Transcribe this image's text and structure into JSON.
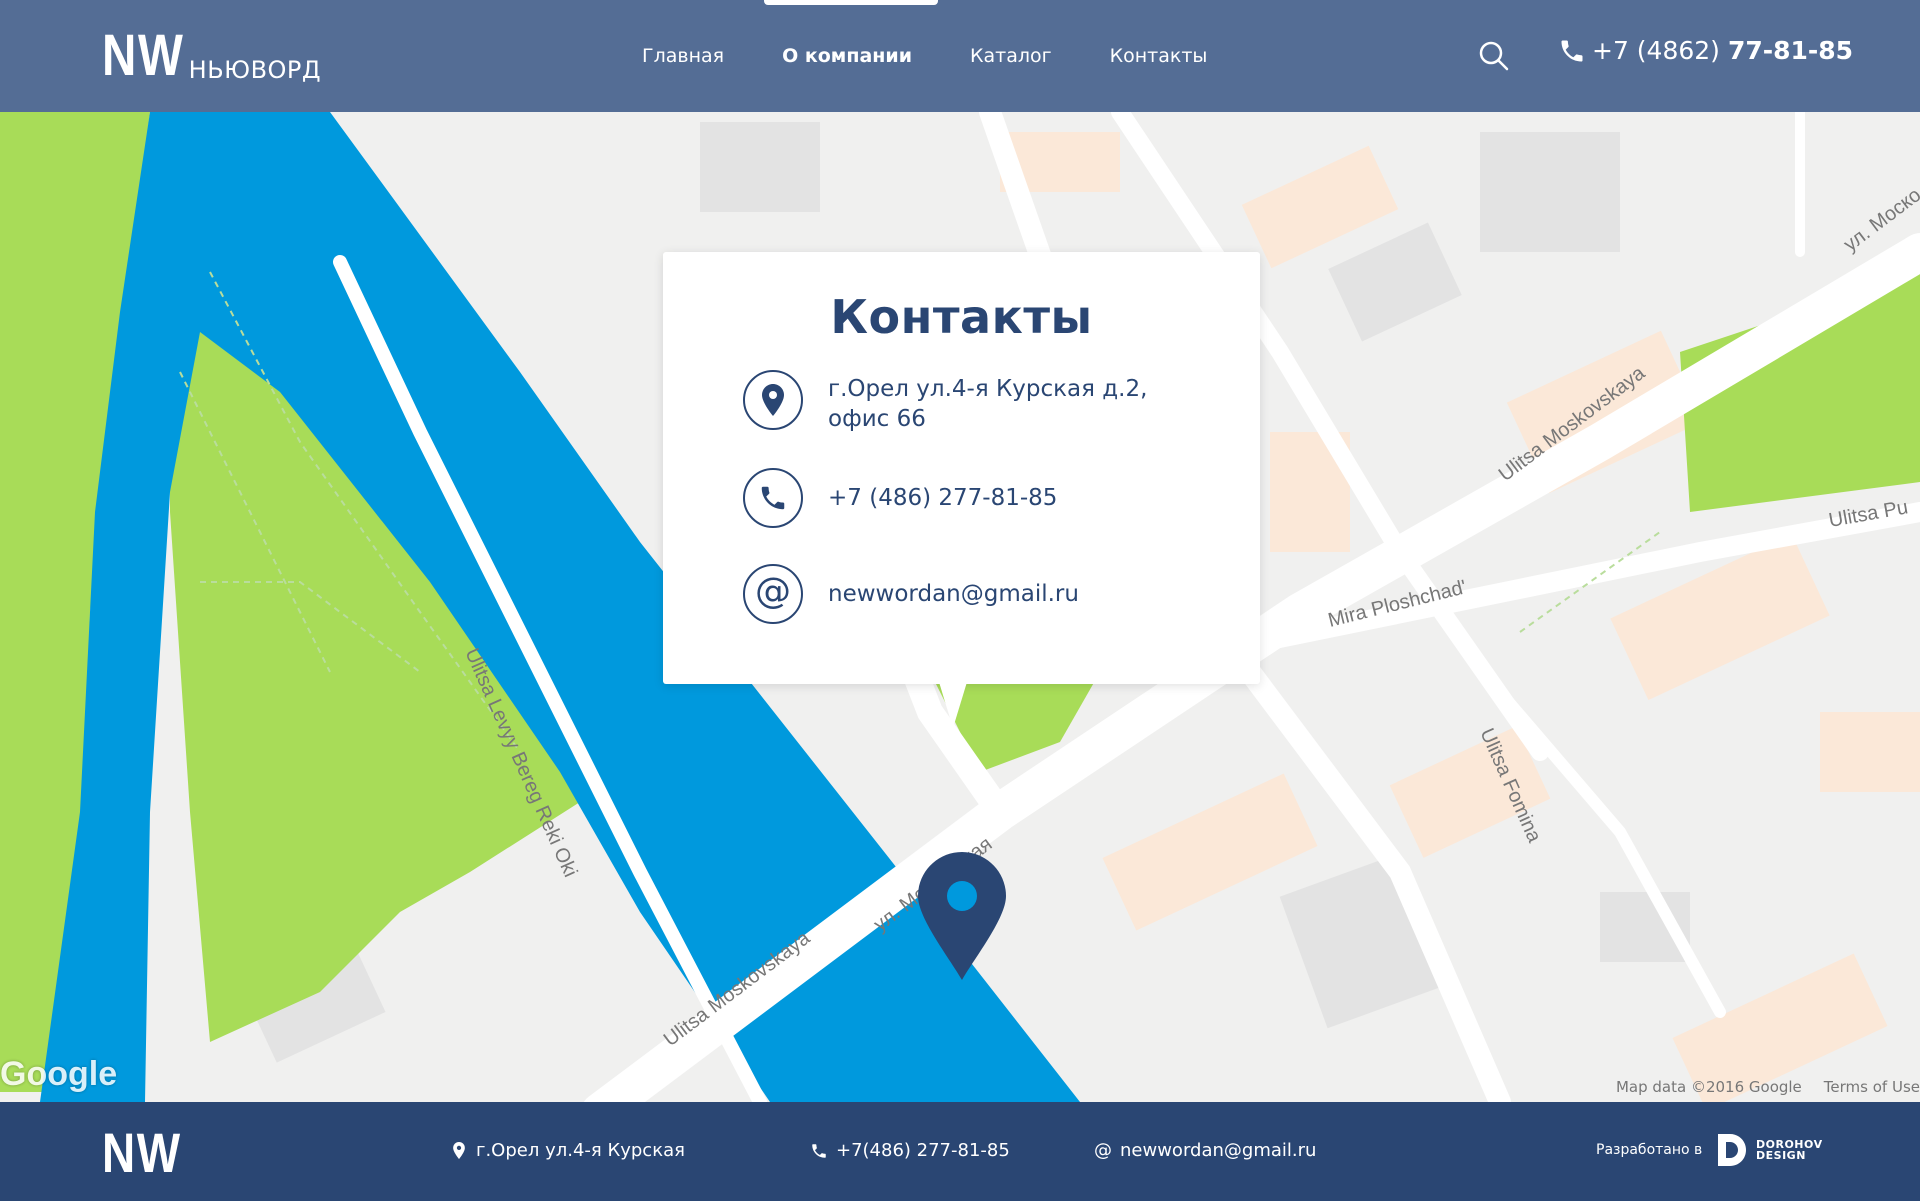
{
  "header": {
    "logo_mark": "NW",
    "logo_text": "НЬЮВОРД",
    "nav": [
      {
        "label": "Главная",
        "active": false
      },
      {
        "label": "О компании",
        "active": true
      },
      {
        "label": "Каталог",
        "active": false
      },
      {
        "label": "Контакты",
        "active": false
      }
    ],
    "phone_prefix": "+7 (4862)",
    "phone_main": "77-81-85",
    "search_icon": "search-icon",
    "phone_icon": "phone-icon"
  },
  "map": {
    "street_labels": [
      "Ulitsa Moskovskaya",
      "ул. Московская",
      "Mira Ploshchad'",
      "Ulitsa Levyy Bereg Reki Oki",
      "Ulitsa Fomina",
      "ул. Моско",
      "Ulitsa Pu"
    ],
    "google_logo": "Google",
    "attribution": "Map data ©2016 Google",
    "terms": "Terms of Use"
  },
  "contacts_card": {
    "title": "Контакты",
    "address_line1": "г.Орел ул.4-я Курская д.2,",
    "address_line2": "офис 66",
    "phone": "+7 (486) 277-81-85",
    "email": "newwordan@gmail.ru",
    "icons": [
      "location-pin-icon",
      "phone-icon",
      "at-icon"
    ]
  },
  "footer": {
    "logo": "NW",
    "address": "г.Орел ул.4-я Курская",
    "phone": "+7(486)  277-81-85",
    "email": "newwordan@gmail.ru",
    "developed_by": "Разработано в",
    "studio_line1": "DOROHOV",
    "studio_line2": "DESIGN"
  },
  "colors": {
    "header_bg": "#546d95",
    "footer_bg": "#2a4673",
    "accent_dark": "#2a4673",
    "water": "#0099dd",
    "park": "#a8dc58"
  }
}
